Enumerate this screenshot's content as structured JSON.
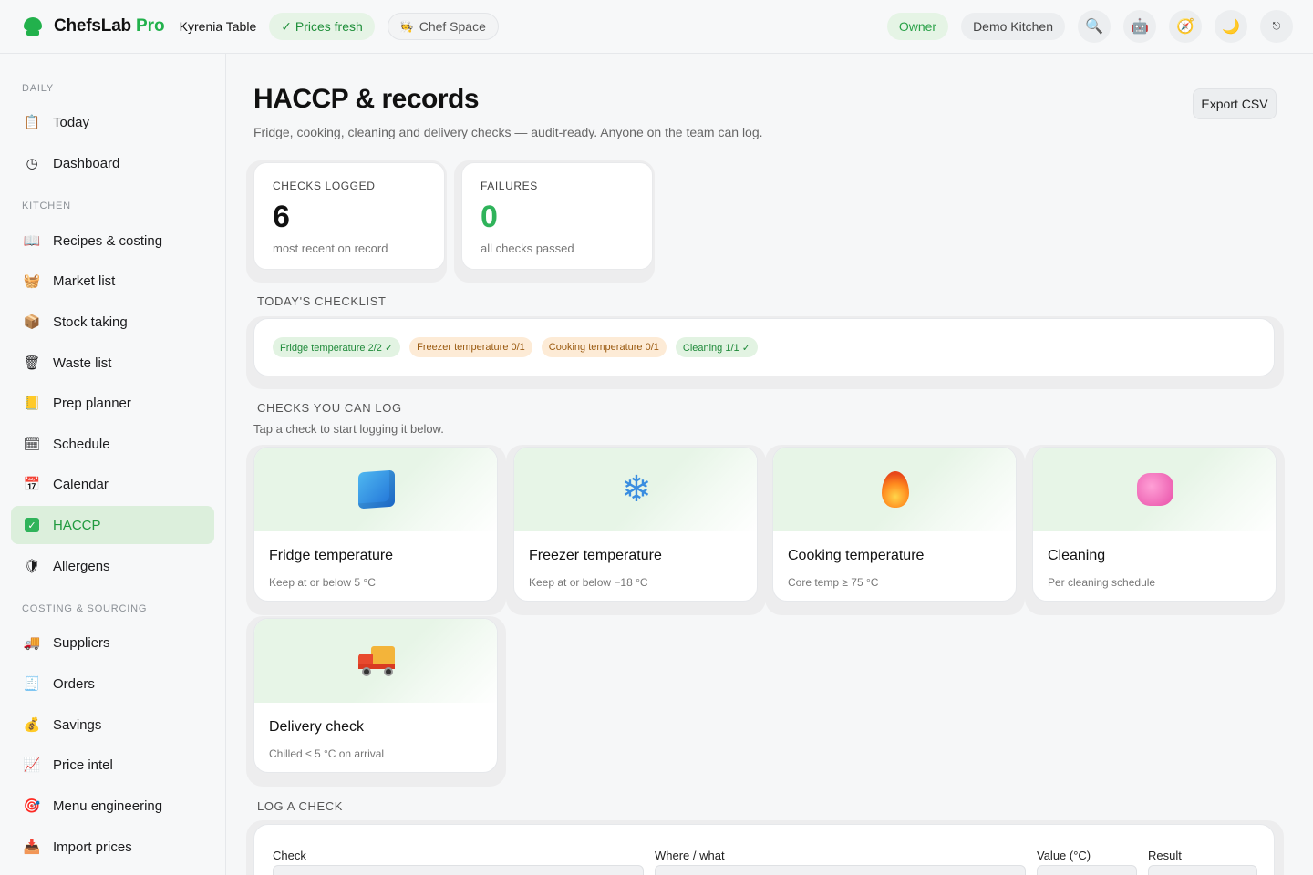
{
  "app": {
    "brand": "ChefsLab",
    "brand_suffix": "Pro",
    "venue": "Kyrenia Table",
    "prices_status": "✓ Prices fresh",
    "chef_space": "Chef Space",
    "role": "Owner",
    "kitchen": "Demo Kitchen",
    "accent_color": "#22b14c"
  },
  "sidebar": {
    "sections": [
      {
        "label": "DAILY"
      },
      {
        "label": "KITCHEN"
      },
      {
        "label": "COSTING & SOURCING"
      }
    ],
    "items": [
      {
        "label": "Today",
        "icon": "clipboard-icon"
      },
      {
        "label": "Dashboard",
        "icon": "clock-icon"
      },
      {
        "label": "Recipes & costing",
        "icon": "book-icon"
      },
      {
        "label": "Market list",
        "icon": "basket-icon"
      },
      {
        "label": "Stock taking",
        "icon": "package-icon"
      },
      {
        "label": "Waste list",
        "icon": "wastebasket-icon"
      },
      {
        "label": "Prep planner",
        "icon": "ledger-icon"
      },
      {
        "label": "Schedule",
        "icon": "calendar-icon"
      },
      {
        "label": "Calendar",
        "icon": "calendar-icon"
      },
      {
        "label": "HACCP",
        "icon": "check-box-icon",
        "active": true
      },
      {
        "label": "Allergens",
        "icon": "shield-icon"
      },
      {
        "label": "Suppliers",
        "icon": "truck-icon"
      },
      {
        "label": "Orders",
        "icon": "receipt-icon"
      },
      {
        "label": "Savings",
        "icon": "money-bag-icon"
      },
      {
        "label": "Price intel",
        "icon": "chart-icon"
      },
      {
        "label": "Menu engineering",
        "icon": "target-icon"
      },
      {
        "label": "Import prices",
        "icon": "inbox-icon"
      }
    ]
  },
  "page": {
    "title": "HACCP & records",
    "subtitle": "Fridge, cooking, cleaning and delivery checks — audit-ready. Anyone on the team can log.",
    "export_label": "Export CSV"
  },
  "stats": [
    {
      "label": "CHECKS LOGGED",
      "value": "6",
      "sub": "most recent on record"
    },
    {
      "label": "FAILURES",
      "value": "0",
      "sub": "all checks passed"
    }
  ],
  "checklist": {
    "heading": "TODAY'S CHECKLIST",
    "chips": [
      {
        "label": "Fridge temperature 2/2 ✓",
        "status": "ok"
      },
      {
        "label": "Freezer temperature 0/1",
        "status": "pending"
      },
      {
        "label": "Cooking temperature 0/1",
        "status": "pending"
      },
      {
        "label": "Cleaning 1/1 ✓",
        "status": "ok"
      }
    ]
  },
  "checks": {
    "heading": "CHECKS YOU CAN LOG",
    "hint": "Tap a check to start logging it below.",
    "cards": [
      {
        "title": "Fridge temperature",
        "desc": "Keep at or below 5 °C",
        "icon": "ice-cube-icon"
      },
      {
        "title": "Freezer temperature",
        "desc": "Keep at or below −18 °C",
        "icon": "snowflake-icon"
      },
      {
        "title": "Cooking temperature",
        "desc": "Core temp ≥ 75 °C",
        "icon": "fire-icon"
      },
      {
        "title": "Cleaning",
        "desc": "Per cleaning schedule",
        "icon": "sponge-icon"
      },
      {
        "title": "Delivery check",
        "desc": "Chilled ≤ 5 °C on arrival",
        "icon": "delivery-truck-icon"
      }
    ]
  },
  "log": {
    "heading": "LOG A CHECK",
    "fields": [
      {
        "label": "Check"
      },
      {
        "label": "Where / what"
      },
      {
        "label": "Value (°C)"
      },
      {
        "label": "Result"
      }
    ]
  }
}
